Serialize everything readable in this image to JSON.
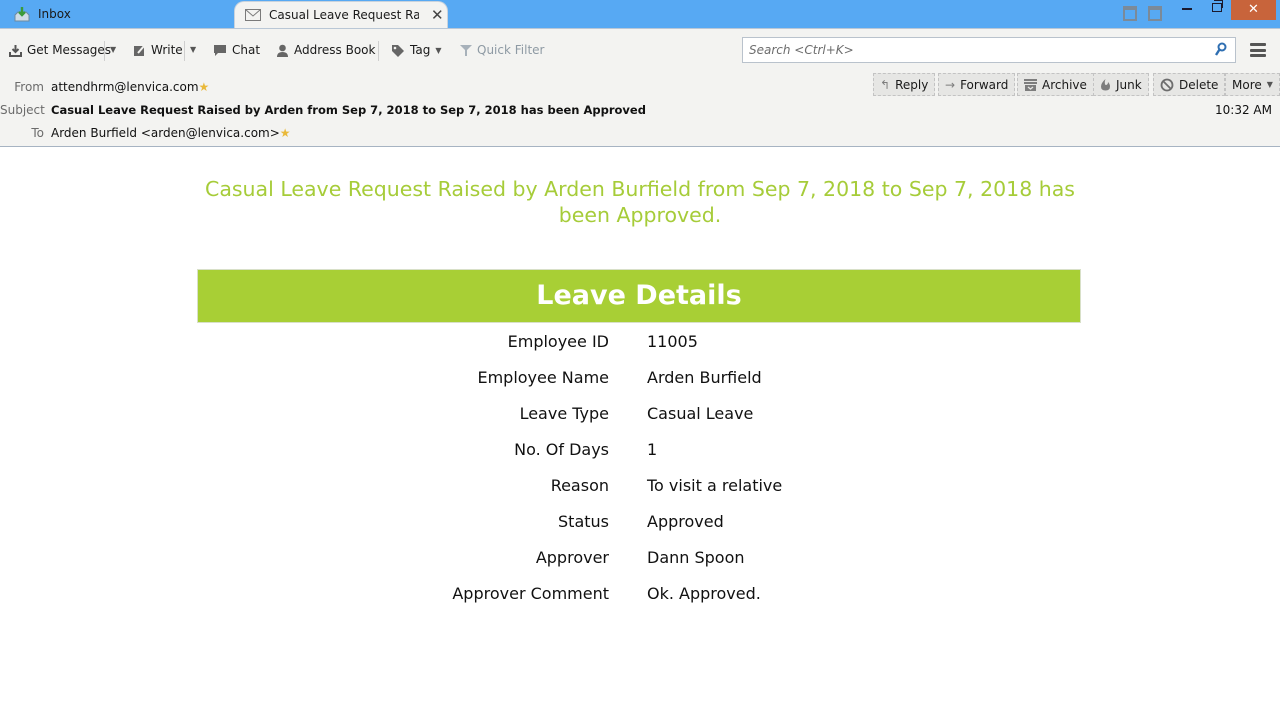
{
  "tabs": {
    "inbox_label": "Inbox",
    "active_label": "Casual Leave Request Rais...",
    "close_glyph": "✕"
  },
  "window_controls": {
    "close_glyph": "✕"
  },
  "toolbar": {
    "get_messages": "Get Messages",
    "write": "Write",
    "chat": "Chat",
    "address_book": "Address Book",
    "tag": "Tag",
    "quick_filter": "Quick Filter",
    "dropdown_glyph": "▼",
    "search_placeholder": "Search <Ctrl+K>"
  },
  "header": {
    "from_label": "From",
    "from_value": "attendhrm@lenvica.com",
    "subject_label": "Subject",
    "subject_value": "Casual Leave Request Raised by Arden from Sep 7, 2018 to Sep 7, 2018 has been Approved",
    "to_label": "To",
    "to_value": "Arden Burfield <arden@lenvica.com>",
    "star_glyph": "★",
    "time": "10:32 AM",
    "actions": {
      "reply": "Reply",
      "forward": "Forward",
      "archive": "Archive",
      "junk": "Junk",
      "delete": "Delete",
      "more": "More",
      "more_arrow": "▼"
    }
  },
  "body": {
    "title": "Casual Leave Request Raised by Arden Burfield from Sep 7, 2018 to Sep 7, 2018 has been Approved.",
    "banner": "Leave Details",
    "details": [
      {
        "label": "Employee ID",
        "value": "11005"
      },
      {
        "label": "Employee Name",
        "value": "Arden Burfield"
      },
      {
        "label": "Leave Type",
        "value": "Casual Leave"
      },
      {
        "label": "No. Of Days",
        "value": "1"
      },
      {
        "label": "Reason",
        "value": "To visit a relative"
      },
      {
        "label": "Status",
        "value": "Approved"
      },
      {
        "label": "Approver",
        "value": "Dann Spoon"
      },
      {
        "label": "Approver Comment",
        "value": "Ok. Approved."
      }
    ]
  },
  "colors": {
    "titlebar": "#57a9f3",
    "accent_green": "#a8cf35",
    "title_green": "#a6cc39",
    "close_red": "#c8643b"
  }
}
